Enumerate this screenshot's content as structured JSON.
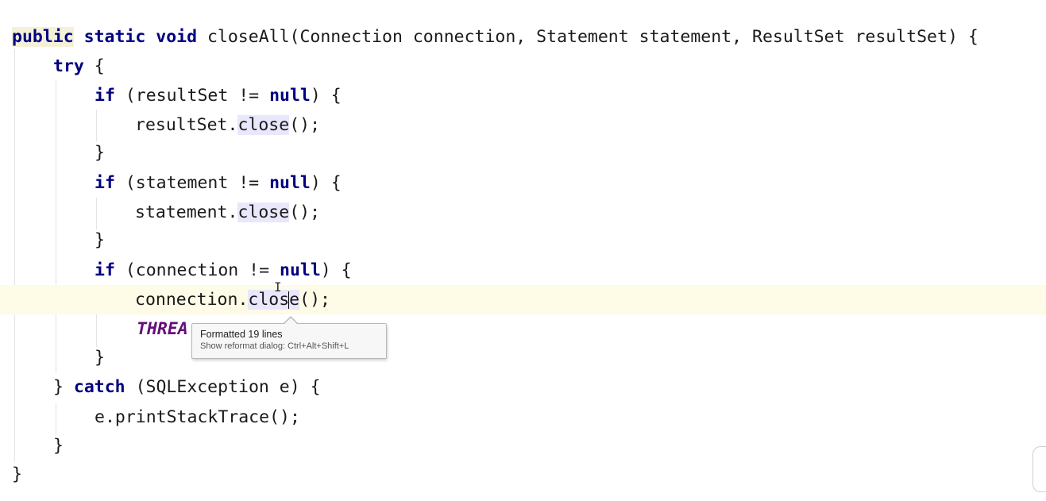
{
  "editor": {
    "language": "java",
    "lines": [
      {
        "segments": [
          {
            "text": "public",
            "kind": "kw-decl"
          },
          {
            "text": " ",
            "kind": "plain"
          },
          {
            "text": "static",
            "kind": "kw"
          },
          {
            "text": " ",
            "kind": "plain"
          },
          {
            "text": "void",
            "kind": "kw"
          },
          {
            "text": " closeAll(Connection connection, Statement statement, ResultSet resultSet) {",
            "kind": "plain"
          }
        ]
      },
      {
        "segments": [
          {
            "text": "try",
            "kind": "kw"
          },
          {
            "text": " {",
            "kind": "plain"
          }
        ]
      },
      {
        "segments": [
          {
            "text": "if",
            "kind": "kw"
          },
          {
            "text": " (resultSet != ",
            "kind": "plain"
          },
          {
            "text": "null",
            "kind": "kw"
          },
          {
            "text": ") {",
            "kind": "plain"
          }
        ]
      },
      {
        "segments": [
          {
            "text": "resultSet.",
            "kind": "plain"
          },
          {
            "text": "close",
            "kind": "ref"
          },
          {
            "text": "();",
            "kind": "plain"
          }
        ]
      },
      {
        "segments": [
          {
            "text": "}",
            "kind": "plain"
          }
        ]
      },
      {
        "segments": [
          {
            "text": "if",
            "kind": "kw"
          },
          {
            "text": " (statement != ",
            "kind": "plain"
          },
          {
            "text": "null",
            "kind": "kw"
          },
          {
            "text": ") {",
            "kind": "plain"
          }
        ]
      },
      {
        "segments": [
          {
            "text": "statement.",
            "kind": "plain"
          },
          {
            "text": "close",
            "kind": "ref"
          },
          {
            "text": "();",
            "kind": "plain"
          }
        ]
      },
      {
        "segments": [
          {
            "text": "}",
            "kind": "plain"
          }
        ]
      },
      {
        "segments": [
          {
            "text": "if",
            "kind": "kw"
          },
          {
            "text": " (connection != ",
            "kind": "plain"
          },
          {
            "text": "null",
            "kind": "kw"
          },
          {
            "text": ") {",
            "kind": "plain"
          }
        ]
      },
      {
        "segments": [
          {
            "text": "connection.",
            "kind": "plain"
          },
          {
            "text": "clos",
            "kind": "ref"
          },
          {
            "text": "",
            "kind": "caret"
          },
          {
            "text": "e",
            "kind": "ref"
          },
          {
            "text": "();",
            "kind": "plain"
          }
        ]
      },
      {
        "segments": [
          {
            "text": "THREA",
            "kind": "const"
          }
        ]
      },
      {
        "segments": [
          {
            "text": "}",
            "kind": "plain"
          }
        ]
      },
      {
        "segments": [
          {
            "text": "} ",
            "kind": "plain"
          },
          {
            "text": "catch",
            "kind": "kw"
          },
          {
            "text": " (SQLException e) {",
            "kind": "plain"
          }
        ]
      },
      {
        "segments": [
          {
            "text": "e.printStackTrace();",
            "kind": "plain"
          }
        ]
      },
      {
        "segments": [
          {
            "text": "}",
            "kind": "plain"
          }
        ]
      },
      {
        "segments": [
          {
            "text": "}",
            "kind": "plain"
          }
        ]
      }
    ]
  },
  "tooltip": {
    "title": "Formatted 19 lines",
    "hint": "Show reformat dialog: Ctrl+Alt+Shift+L"
  },
  "colors": {
    "keyword": "#000080",
    "constant": "#660e7a",
    "current_line": "#fefbe6",
    "usage_highlight": "#e9e7fb"
  },
  "icons": {
    "mouse_cursor": "text-cursor-icon"
  }
}
